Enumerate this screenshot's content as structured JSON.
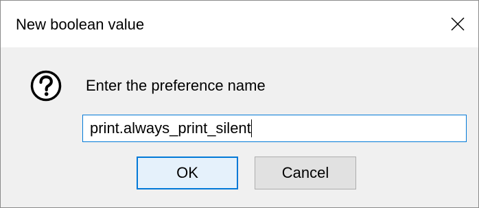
{
  "dialog": {
    "title": "New boolean value",
    "close_icon": "close-icon"
  },
  "content": {
    "icon": "question-icon",
    "prompt": "Enter the preference name",
    "input_value": "print.always_print_silent"
  },
  "buttons": {
    "ok_label": "OK",
    "cancel_label": "Cancel"
  },
  "colors": {
    "accent": "#0078d7",
    "titlebar_bg": "#ffffff",
    "dialog_bg": "#f0f0f0",
    "button_bg": "#e1e1e1"
  }
}
